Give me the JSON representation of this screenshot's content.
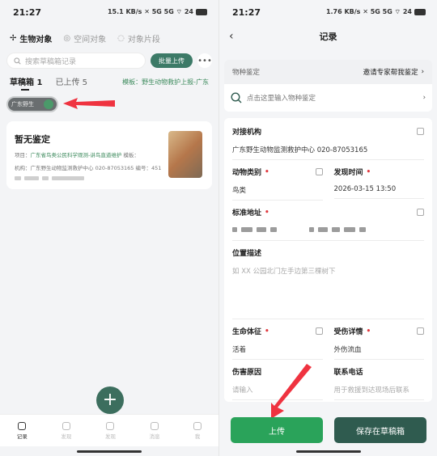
{
  "left": {
    "status": {
      "time": "21:27",
      "icons": "15.1 KB/s ✕ 5G 5G ⌔ 24"
    },
    "tabs": [
      {
        "label": "生物对象",
        "icon": "bird-icon"
      },
      {
        "label": "空间对象",
        "icon": "location-icon"
      },
      {
        "label": "对象片段",
        "icon": "clip-icon"
      }
    ],
    "search": {
      "placeholder": "搜索草稿箱记录",
      "upload_all": "批量上传",
      "more": "•••"
    },
    "subtabs": [
      {
        "label": "草稿箱 1"
      },
      {
        "label": "已上传 5"
      }
    ],
    "template_text": "模板：野生动物救护上报-广东",
    "chip_text": "广东野生",
    "card": {
      "title": "暂无鉴定",
      "line1_label": "项目：",
      "line1_value": "广东省鸟类公民科学观测-讲鸟直道维护",
      "line1_extra": "模板：",
      "line2": "机构：广东野生动物监测救护中心 020-87053165",
      "line2_extra": "编号：451"
    },
    "fab": "+",
    "nav": [
      {
        "label": "记录"
      },
      {
        "label": "发现"
      },
      {
        "label": "发现"
      },
      {
        "label": "消息"
      },
      {
        "label": "我"
      }
    ]
  },
  "right": {
    "status": {
      "time": "21:27",
      "icons": "1.76 KB/s ✕ 5G 5G ⌔ 24"
    },
    "title": "记录",
    "back": "‹",
    "species_label": "物种鉴定",
    "invite_text": "邀请专家帮我鉴定",
    "species_placeholder": "点击这里输入物种鉴定",
    "fields": {
      "agency": {
        "label": "对接机构",
        "value": "广东野生动物监测救护中心 020-87053165"
      },
      "animal_type": {
        "label": "动物类别",
        "value": "鸟类"
      },
      "found_time": {
        "label": "发现时间",
        "value": "2026-03-15 13:50"
      },
      "address": {
        "label": "标准地址"
      },
      "location_desc": {
        "label": "位置描述",
        "placeholder": "如 XX 公园北门左手边第三棵树下"
      },
      "vital_signs": {
        "label": "生命体征",
        "value": "活着"
      },
      "injury": {
        "label": "受伤详情",
        "value": "外伤流血"
      },
      "injury_cause": {
        "label": "伤害原因",
        "placeholder": "请输入"
      },
      "phone": {
        "label": "联系电话",
        "placeholder": "用于救援到达现场后联系"
      }
    },
    "buttons": {
      "upload": "上传",
      "save_draft": "保存在草稿箱"
    }
  },
  "colors": {
    "accent_green": "#2aa35a",
    "dark_green": "#2f5b4f",
    "required": "#e0383e",
    "arrow": "#ef3340"
  }
}
